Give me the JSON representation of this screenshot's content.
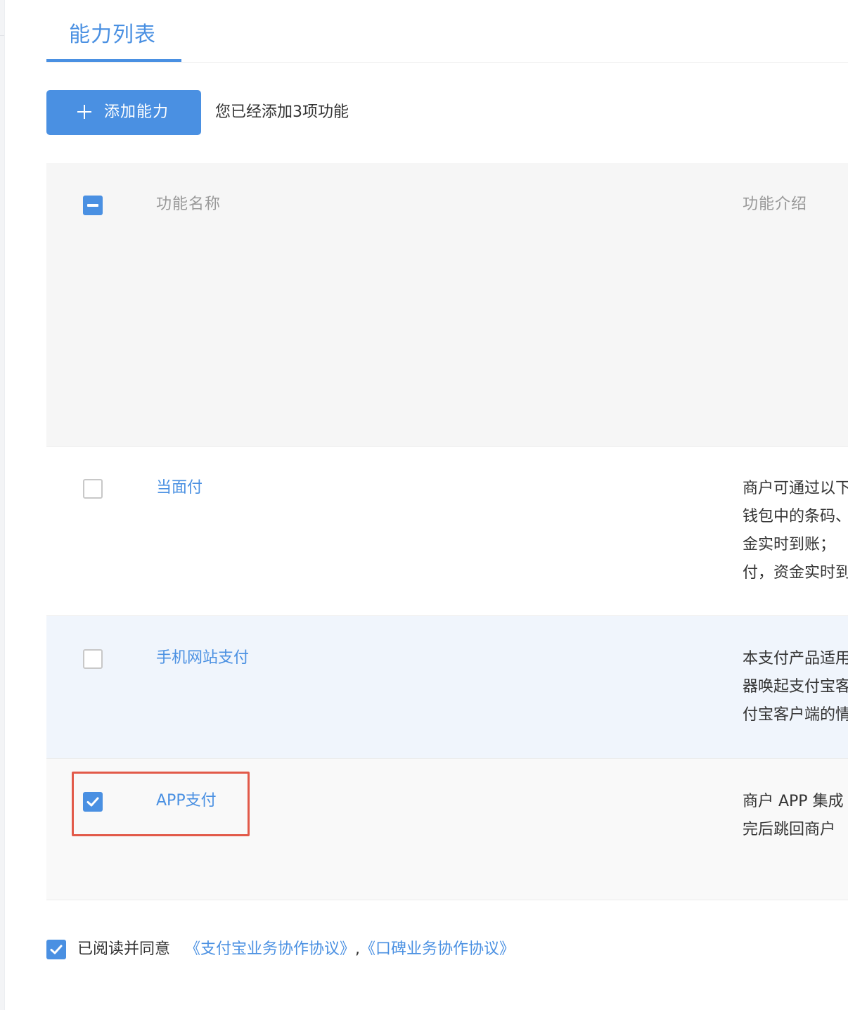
{
  "colors": {
    "accent": "#4a90e2",
    "highlight_border": "#e25a4a",
    "header_bg": "#f6f6f6",
    "hover_row_bg": "#f0f5fc"
  },
  "tabs": [
    {
      "label": "能力列表",
      "active": true
    }
  ],
  "toolbar": {
    "add_icon": "plus-icon",
    "add_label": "添加能力",
    "added_count_text": "您已经添加3项功能"
  },
  "table": {
    "header": {
      "select_all_state": "partial",
      "col_name": "功能名称",
      "col_desc": "功能介绍"
    },
    "rows": [
      {
        "name": "当面付",
        "checked": false,
        "desc_lines": [
          "商户可通过以下",
          "钱包中的条码、",
          "金实时到账；",
          "付，资金实时到"
        ]
      },
      {
        "name": "手机网站支付",
        "checked": false,
        "desc_lines": [
          "本支付产品适用",
          "器唤起支付宝客",
          "付宝客户端的情"
        ]
      },
      {
        "name": "APP支付",
        "checked": true,
        "highlighted": true,
        "desc_lines": [
          "商户 APP 集成",
          "完后跳回商户"
        ]
      }
    ]
  },
  "agreement": {
    "checked": true,
    "prefix": "已阅读并同意",
    "link1": "《支付宝业务协作协议》",
    "separator": ",",
    "link2": "《口碑业务协作协议》"
  }
}
